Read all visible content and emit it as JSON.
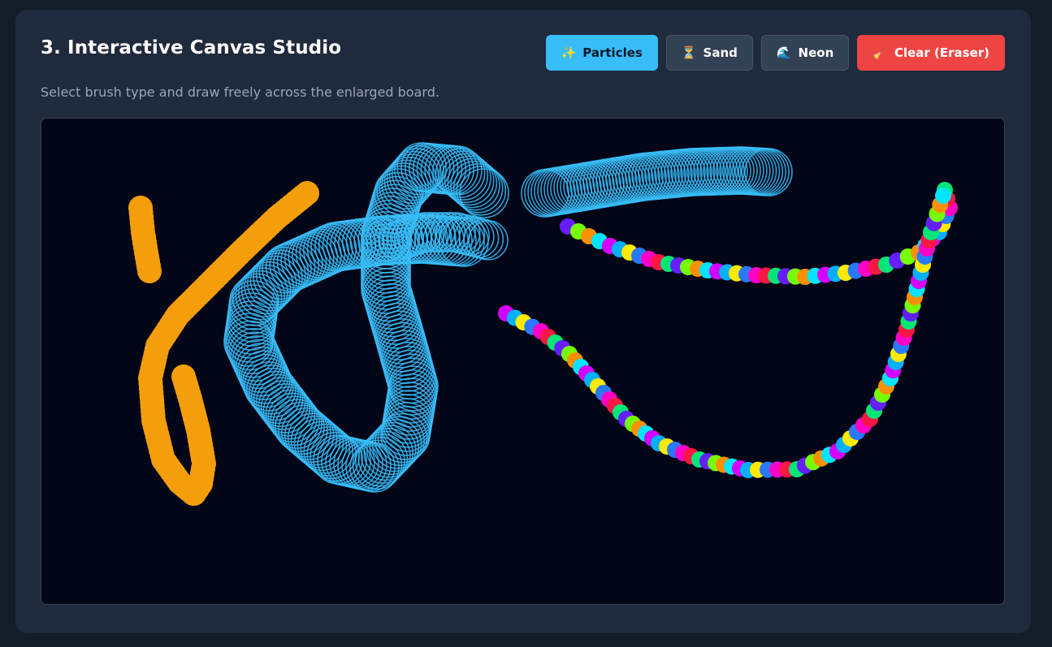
{
  "header": {
    "title": "3. Interactive Canvas Studio",
    "subtitle": "Select brush type and draw freely across the enlarged board."
  },
  "toolbar": {
    "buttons": [
      {
        "icon": "✨",
        "icon_name": "sparkles-icon",
        "label": "Particles",
        "active": true
      },
      {
        "icon": "⏳",
        "icon_name": "hourglass-icon",
        "label": "Sand",
        "active": false
      },
      {
        "icon": "🌊",
        "icon_name": "wave-icon",
        "label": "Neon",
        "active": false
      },
      {
        "icon": "🧹",
        "icon_name": "broom-icon",
        "label": "Clear (Eraser)",
        "active": false
      }
    ]
  },
  "colors": {
    "accent": "#38bdf8",
    "danger": "#ef4444",
    "sand": "#f59e0b",
    "neon": "#38bdf8",
    "board": "#020617",
    "card": "#1f2a3c"
  },
  "canvas": {
    "strokes": [
      {
        "brush": "sand",
        "label": "orange short stroke"
      },
      {
        "brush": "sand",
        "label": "orange long stroke"
      },
      {
        "brush": "sand",
        "label": "orange hook stroke"
      },
      {
        "brush": "neon",
        "label": "blue loop stroke"
      },
      {
        "brush": "neon",
        "label": "blue ring stroke"
      },
      {
        "brush": "neon",
        "label": "blue top stroke"
      },
      {
        "brush": "particles",
        "label": "rainbow upper arc"
      },
      {
        "brush": "particles",
        "label": "rainbow lower arc"
      }
    ]
  }
}
